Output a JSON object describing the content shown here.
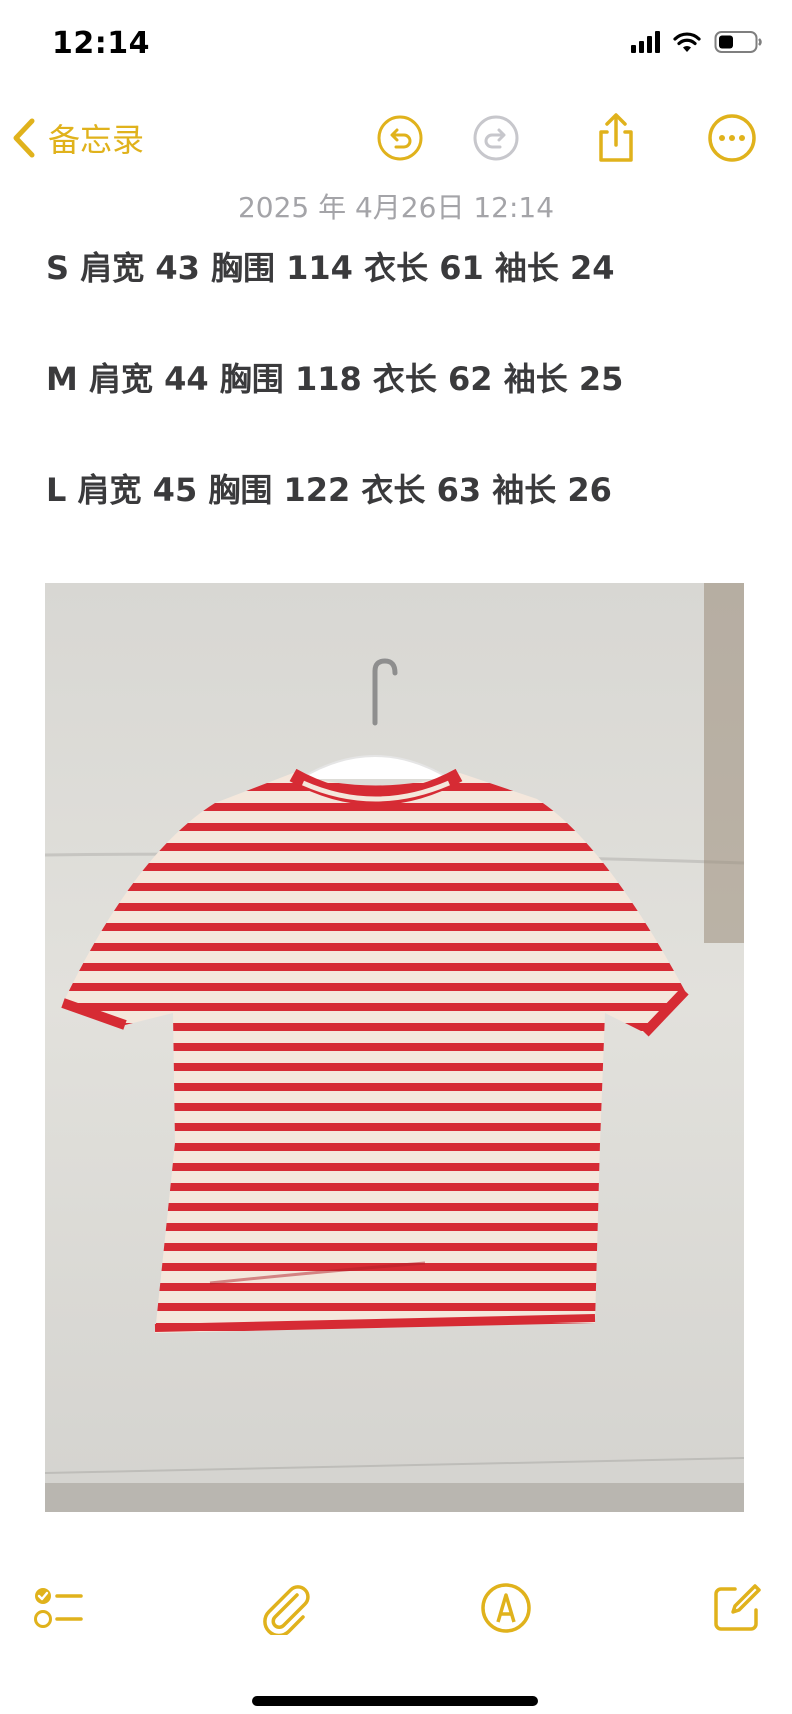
{
  "status_bar": {
    "time": "12:14",
    "signal_icon": "cellular-signal-icon",
    "wifi_icon": "wifi-icon",
    "battery_icon": "battery-icon"
  },
  "nav": {
    "back_label": "备忘录",
    "back_icon": "chevron-left-icon",
    "undo_icon": "undo-icon",
    "redo_icon": "redo-icon",
    "share_icon": "share-icon",
    "more_icon": "ellipsis-circle-icon",
    "accent_color": "#e0b21c"
  },
  "note": {
    "date": "2025 年 4月26日 12:14",
    "lines": [
      "S 肩宽 43 胸围 114 衣长 61 袖长 24",
      "M 肩宽 44 胸围 118 衣长 62 袖长 25",
      "L 肩宽 45 胸围 122 衣长 63 袖长 26"
    ]
  },
  "toolbar": {
    "checklist_icon": "checklist-icon",
    "attachment_icon": "paperclip-icon",
    "markup_icon": "markup-pen-icon",
    "compose_icon": "compose-icon"
  }
}
